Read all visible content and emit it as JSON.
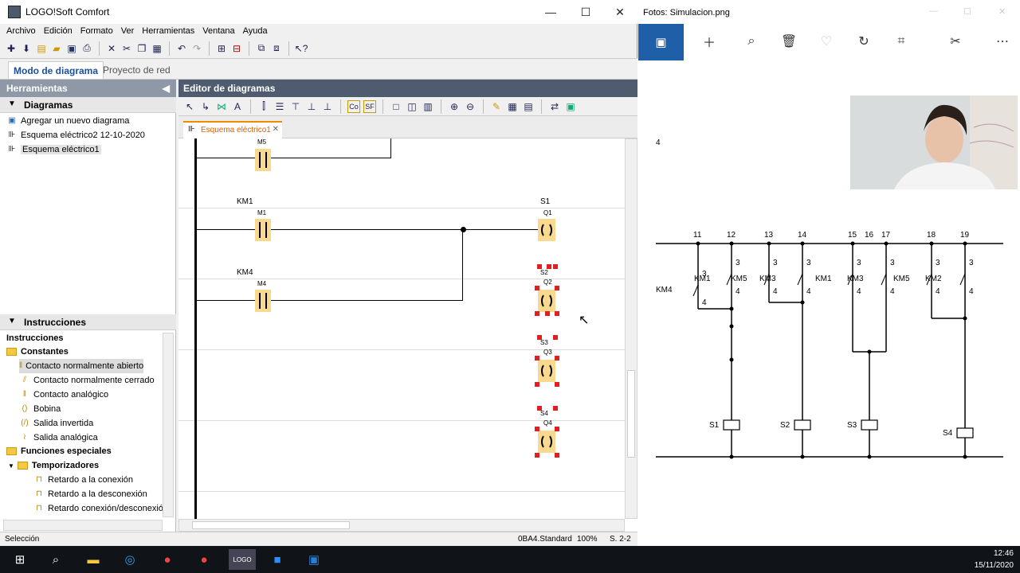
{
  "logo": {
    "title": "LOGO!Soft Comfort",
    "menu": [
      "Archivo",
      "Edición",
      "Formato",
      "Ver",
      "Herramientas",
      "Ventana",
      "Ayuda"
    ],
    "mode_tabs": {
      "active": "Modo de diagrama",
      "other": "Proyecto de red"
    },
    "tools_panel": {
      "header": "Herramientas",
      "diagrams_section": "Diagramas",
      "diagram_items": [
        "Agregar un nuevo diagrama",
        "Esquema eléctrico2 12-10-2020",
        "Esquema eléctrico1"
      ],
      "instructions_section": "Instrucciones",
      "instructions_root": "Instrucciones",
      "constants": "Constantes",
      "constant_items": [
        "Contacto normalmente abierto",
        "Contacto normalmente cerrado",
        "Contacto analógico",
        "Bobina",
        "Salida invertida",
        "Salida analógica"
      ],
      "special": "Funciones especiales",
      "timers": "Temporizadores",
      "timer_items": [
        "Retardo a la conexión",
        "Retardo a la desconexión",
        "Retardo conexión/desconexión"
      ]
    },
    "editor": {
      "header": "Editor de diagramas",
      "doc_tab": "Esquema eléctrico1",
      "rungs": {
        "r0_contact": "M5",
        "r1_label": "KM1",
        "r1_contact": "M1",
        "r1_out_label": "S1",
        "r1_coil": "Q1",
        "r2_label": "KM4",
        "r2_contact": "M4",
        "r2_out_label": "S2",
        "r2_coil": "Q2",
        "r3_out_label": "S3",
        "r3_coil": "Q3",
        "r4_out_label": "S4",
        "r4_coil": "Q4"
      }
    },
    "status": {
      "left": "Selección",
      "device": "0BA4.Standard",
      "zoom": "100%",
      "page": "S. 2-2"
    }
  },
  "photos": {
    "title": "Fotos: Simulacion.png",
    "page_num": "4",
    "nodes": [
      "11",
      "12",
      "13",
      "14",
      "15",
      "16",
      "17",
      "18",
      "19"
    ],
    "contacts": [
      {
        "name": "KM4",
        "top": "3",
        "bottom": "4"
      },
      {
        "name": "KM1",
        "top": "3",
        "bottom": "4"
      },
      {
        "name": "KM5",
        "top": "3",
        "bottom": "4"
      },
      {
        "name": "KM3",
        "top": "3",
        "bottom": "4"
      },
      {
        "name": "KM1",
        "top": "3",
        "bottom": "4"
      },
      {
        "name": "KM3",
        "top": "3",
        "bottom": "4"
      },
      {
        "name": "KM5",
        "top": "3",
        "bottom": "4"
      },
      {
        "name": "KM2",
        "top": "3",
        "bottom": "4"
      }
    ],
    "coils": [
      "S1",
      "S2",
      "S3",
      "S4"
    ]
  },
  "taskbar": {
    "time": "12:46",
    "date": "15/11/2020"
  }
}
